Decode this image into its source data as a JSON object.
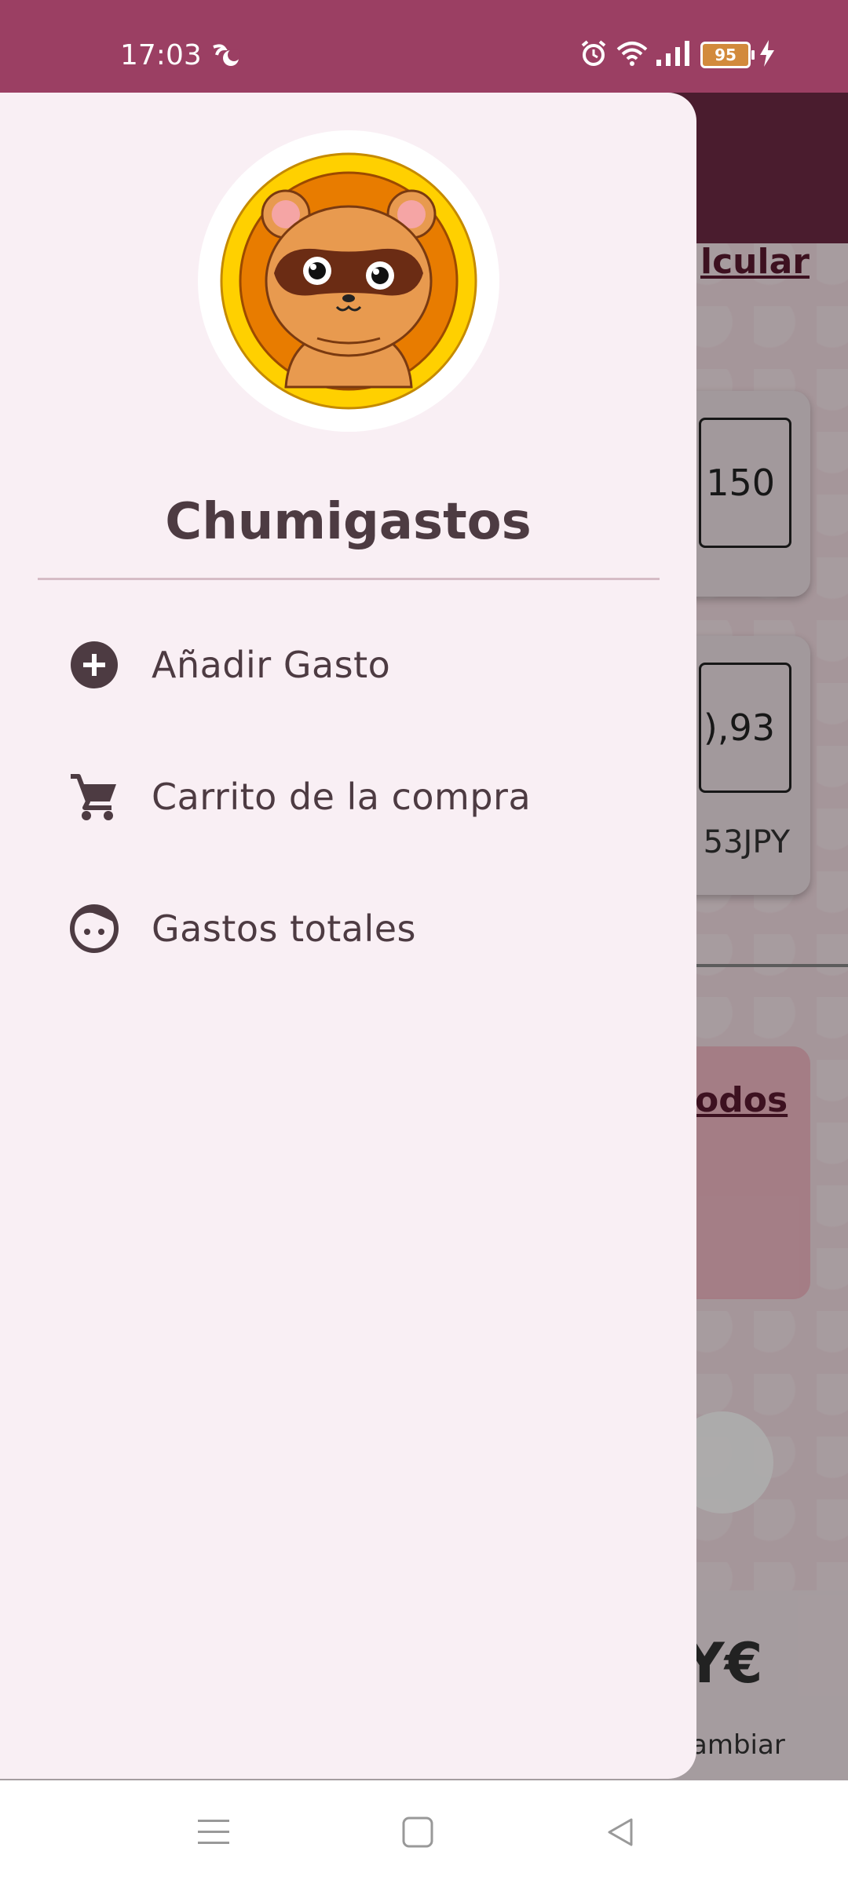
{
  "status_bar": {
    "time": "17:03",
    "battery_level": "95",
    "icons": [
      "wind-moon-icon",
      "alarm-icon",
      "wifi-icon",
      "signal-icon",
      "battery-icon",
      "charging-icon"
    ]
  },
  "background_app": {
    "link_partial": "lcular",
    "card1_value_partial": "150",
    "card2_value_partial": "),93",
    "card2_sub_partial": "53JPY",
    "pink_link_partial": "odos",
    "nav_label_partial": "ambiar",
    "nav_icon_partial": "Y€"
  },
  "drawer": {
    "app_title": "Chumigastos",
    "avatar": "tanuki-logo-icon",
    "items": [
      {
        "label": "Añadir Gasto",
        "icon": "add-circle-icon"
      },
      {
        "label": "Carrito de la compra",
        "icon": "shopping-cart-icon"
      },
      {
        "label": "Gastos totales",
        "icon": "face-icon"
      }
    ]
  },
  "system_nav": {
    "buttons": [
      "menu-icon",
      "home-icon",
      "back-icon"
    ]
  },
  "colors": {
    "status_bar": "#9b3f63",
    "drawer_bg": "#f9eff4",
    "text": "#4d3b42",
    "topbar": "#6d2a44"
  }
}
